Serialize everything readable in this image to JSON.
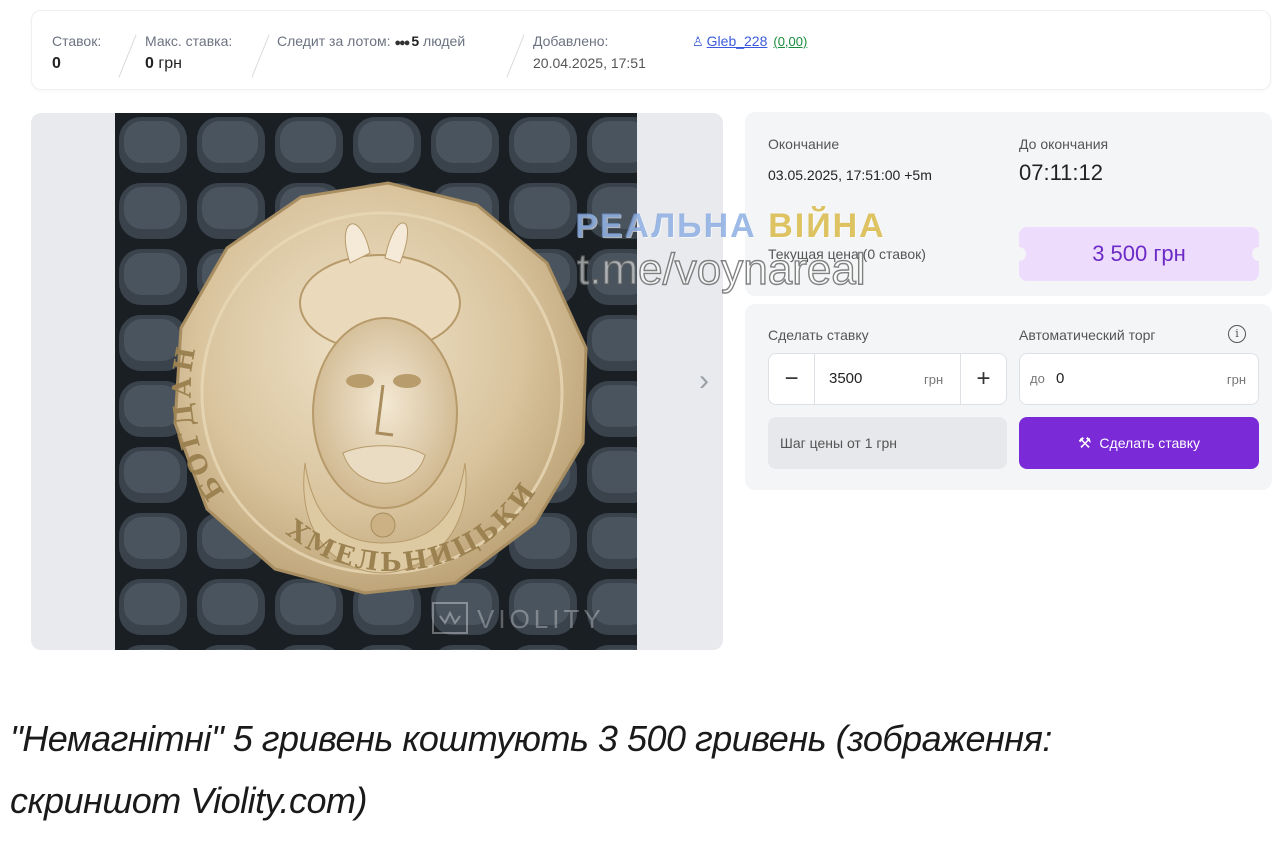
{
  "info_bar": {
    "bids_label": "Ставок:",
    "bids_value": "0",
    "max_bid_label": "Макс. ставка:",
    "max_bid_value": "0",
    "max_bid_unit": "грн",
    "watching_label": "Следит за лотом:",
    "watching_count": "5",
    "watching_unit": "людей",
    "added_label": "Добавлено:",
    "added_date": "20.04.2025, 17:51",
    "seller_name": "Gleb_228",
    "seller_rating": "(0,00)"
  },
  "gallery": {
    "coin_top_text": "БОГДАН",
    "coin_bottom_text": "ХМЕЛЬНИЦЬКИЙ",
    "photo_watermark": "VIOLITY"
  },
  "auction": {
    "end_label": "Окончание",
    "end_value": "03.05.2025, 17:51:00 +5m",
    "remaining_label": "До окончания",
    "remaining_value": "07:11:12",
    "current_price_label": "Текущая цена (0 ставок)",
    "current_price_value": "3 500 грн"
  },
  "bid": {
    "make_bid_label": "Сделать ставку",
    "auto_bid_label": "Автоматический торг",
    "stepper_value": "3500",
    "stepper_unit": "грн",
    "minus": "−",
    "plus": "+",
    "auto_prefix": "до",
    "auto_value": "0",
    "auto_unit": "грн",
    "step_note": "Шаг цены от 1 грн",
    "submit_label": "Сделать ставку"
  },
  "watermark": {
    "line1_part1": "РЕАЛЬНА",
    "line1_part2": "ВІЙНА",
    "line2": "t.me/voynareal"
  },
  "caption": {
    "text": "\"Немагнітні\" 5 гривень коштують 3 500 гривень (зображення: скриншот Violity.com)"
  },
  "colors": {
    "accent_purple": "#7a2ad6",
    "price_bg": "#eedcfc",
    "price_text": "#6c2bc6",
    "link_blue": "#3b5bdb",
    "rating_green": "#1a8d3c"
  }
}
